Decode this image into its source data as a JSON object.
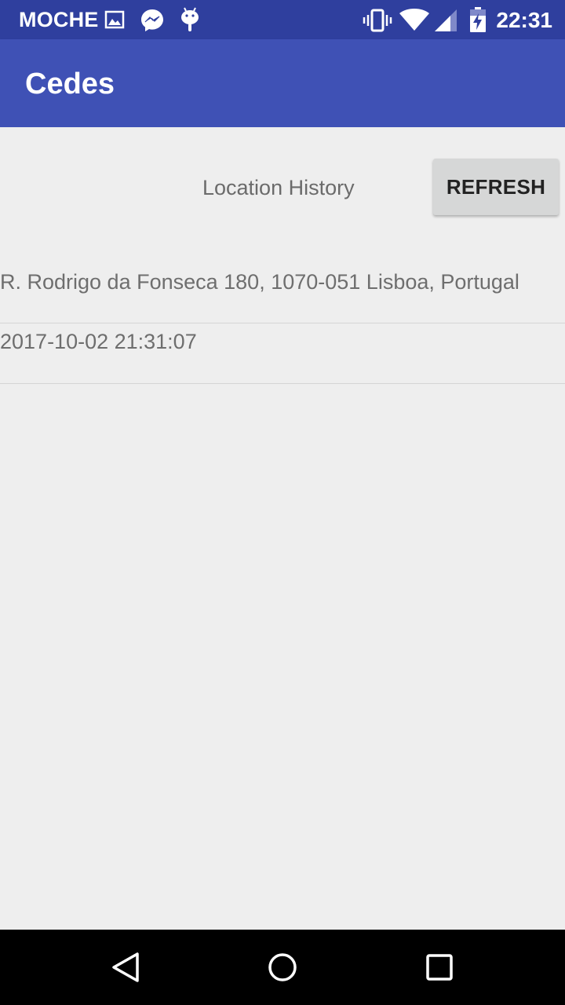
{
  "status_bar": {
    "carrier": "MOCHE",
    "time": "22:31",
    "icons": [
      "image-icon",
      "messenger-icon",
      "android-icon",
      "vibrate-icon",
      "wifi-icon",
      "cellular-signal-icon",
      "battery-charging-icon"
    ]
  },
  "app_bar": {
    "title": "Cedes"
  },
  "main": {
    "section_title": "Location History",
    "refresh_label": "REFRESH",
    "history": [
      {
        "text": "R. Rodrigo da Fonseca 180, 1070-051 Lisboa, Portugal"
      },
      {
        "text": "2017-10-02 21:31:07"
      }
    ]
  },
  "nav_bar": {
    "buttons": [
      "back-icon",
      "home-icon",
      "recents-icon"
    ]
  },
  "colors": {
    "status_bar": "#2f3f9e",
    "app_bar": "#3f51b5",
    "background": "#eeeeee",
    "button": "#d6d7d7"
  }
}
